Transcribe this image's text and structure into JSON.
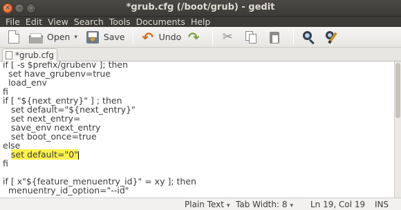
{
  "window": {
    "title": "*grub.cfg (/boot/grub) - gedit",
    "close_glyph": "✕",
    "min_glyph": "–",
    "max_glyph": "□"
  },
  "menubar": {
    "items": [
      "File",
      "Edit",
      "View",
      "Search",
      "Tools",
      "Documents",
      "Help"
    ]
  },
  "toolbar": {
    "open_label": "Open",
    "save_label": "Save",
    "undo_label": "Undo",
    "icons": [
      "new-icon",
      "open-icon",
      "save-icon",
      "undo-icon",
      "redo-icon",
      "cut-icon",
      "copy-icon",
      "paste-icon",
      "find-icon",
      "replace-icon"
    ],
    "undo_glyph": "↶",
    "redo_glyph": "↷",
    "cut_glyph": "✂",
    "caret_glyph": "▾"
  },
  "tab": {
    "label": "*grub.cfg"
  },
  "editor": {
    "lines": [
      "if [ -s $prefix/grubenv ]; then",
      "  set have_grubenv=true",
      "  load_env",
      "fi",
      "if [ \"${next_entry}\" ] ; then",
      "   set default=\"${next_entry}\"",
      "   set next_entry=",
      "   save_env next_entry",
      "   set boot_once=true",
      "else",
      "   set default=\"0\"",
      "fi",
      "",
      "if [ x\"${feature_menuentry_id}\" = xy ]; then",
      "  menuentry_id_option=\"--id\""
    ],
    "selected_line_index": 10,
    "selected_text": "set default=\"0\""
  },
  "statusbar": {
    "language": "Plain Text",
    "tab_width": "Tab Width: 8",
    "position": "Ln 19, Col 19",
    "mode": "INS",
    "caret_glyph": "▾"
  },
  "colors": {
    "titlebar": "#3c3b37",
    "selection": "#fcf04c",
    "accent_close": "#e9541d"
  }
}
